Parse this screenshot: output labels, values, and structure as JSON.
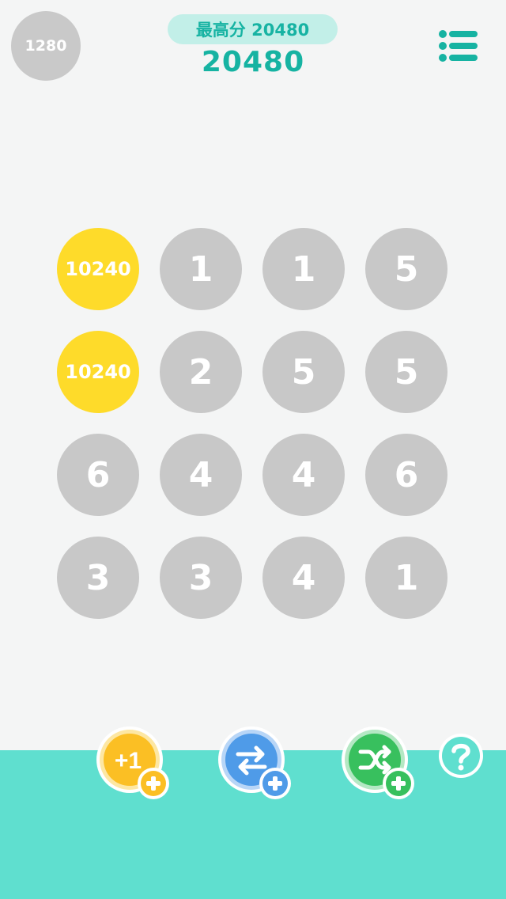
{
  "header": {
    "coins": "1280",
    "best_score_label": "最高分 20480",
    "current_score": "20480"
  },
  "board": {
    "tiles": [
      {
        "value": "10240",
        "color": "#fedb2a"
      },
      {
        "value": "1",
        "color": "#c8c8c8"
      },
      {
        "value": "1",
        "color": "#c8c8c8"
      },
      {
        "value": "5",
        "color": "#c8c8c8"
      },
      {
        "value": "10240",
        "color": "#fedb2a"
      },
      {
        "value": "2",
        "color": "#c8c8c8"
      },
      {
        "value": "5",
        "color": "#c8c8c8"
      },
      {
        "value": "5",
        "color": "#c8c8c8"
      },
      {
        "value": "6",
        "color": "#c8c8c8"
      },
      {
        "value": "4",
        "color": "#c8c8c8"
      },
      {
        "value": "4",
        "color": "#c8c8c8"
      },
      {
        "value": "6",
        "color": "#c8c8c8"
      },
      {
        "value": "3",
        "color": "#c8c8c8"
      },
      {
        "value": "3",
        "color": "#c8c8c8"
      },
      {
        "value": "4",
        "color": "#c8c8c8"
      },
      {
        "value": "1",
        "color": "#c8c8c8"
      }
    ]
  },
  "powerups": [
    {
      "icon": "plus-one-icon",
      "label": "+1",
      "color": "#fbbf24"
    },
    {
      "icon": "swap-icon",
      "color": "#4f9be8"
    },
    {
      "icon": "shuffle-icon",
      "color": "#38c05e"
    }
  ],
  "colors": {
    "accent": "#16b3a2",
    "bottom_bar": "#5fdfcf",
    "background": "#f4f5f5"
  }
}
